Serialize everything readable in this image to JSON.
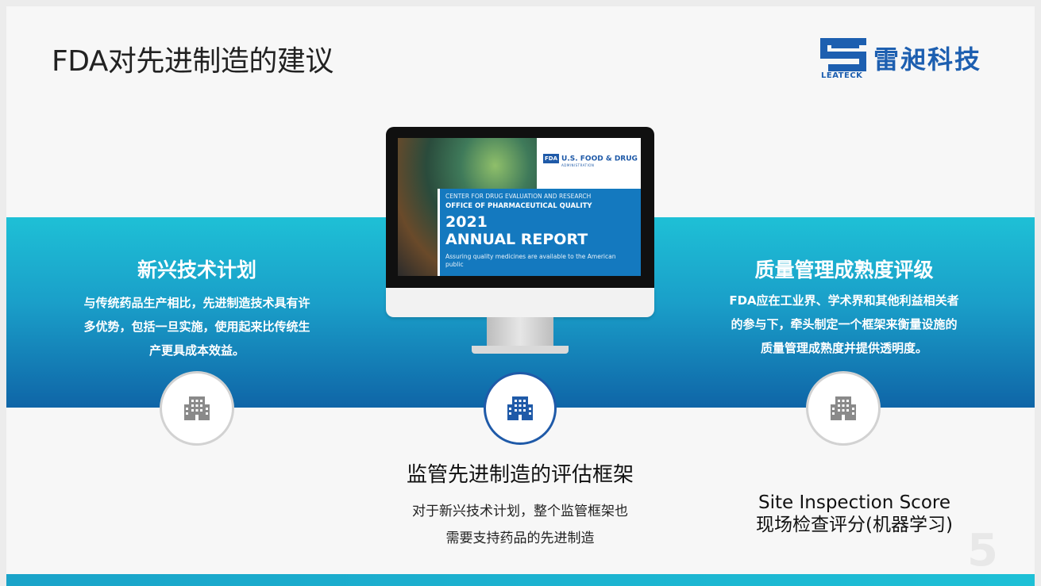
{
  "page": {
    "title": "FDA对先进制造的建议"
  },
  "logo": {
    "name_cn": "雷昶科技",
    "name_en": "LEATECK",
    "color": "#1d5fb0"
  },
  "report_cover": {
    "agency": "U.S. FOOD & DRUG",
    "agency_sub": "ADMINISTRATION",
    "agency_badge": "FDA",
    "center": "CENTER FOR DRUG EVALUATION AND RESEARCH",
    "office": "OFFICE OF PHARMACEUTICAL QUALITY",
    "year": "2021",
    "report": "ANNUAL REPORT",
    "tagline": "Assuring quality medicines are available to the American public"
  },
  "left": {
    "title": "新兴技术计划",
    "lines": [
      "与传统药品生产相比，先进制造技术具有许",
      "多优势，包括一旦实施，使用起来比传统生",
      "产更具成本效益。"
    ],
    "icon": "building-icon"
  },
  "right": {
    "title": "质量管理成熟度评级",
    "lines": [
      "FDA应在工业界、学术界和其他利益相关者",
      "的参与下，牵头制定一个框架来衡量设施的",
      "质量管理成熟度并提供透明度。"
    ],
    "icon": "building-icon",
    "bottom_line1": "Site Inspection Score",
    "bottom_line2": "现场检查评分(机器学习)"
  },
  "center": {
    "title": "监管先进制造的评估框架",
    "lines": [
      "对于新兴技术计划，整个监管框架也",
      "需要支持药品的先进制造"
    ],
    "icon": "building-icon"
  },
  "page_number": "5",
  "colors": {
    "band_top": "#1ec0d6",
    "band_bottom": "#0f65a7",
    "accent": "#1f5aa8"
  }
}
